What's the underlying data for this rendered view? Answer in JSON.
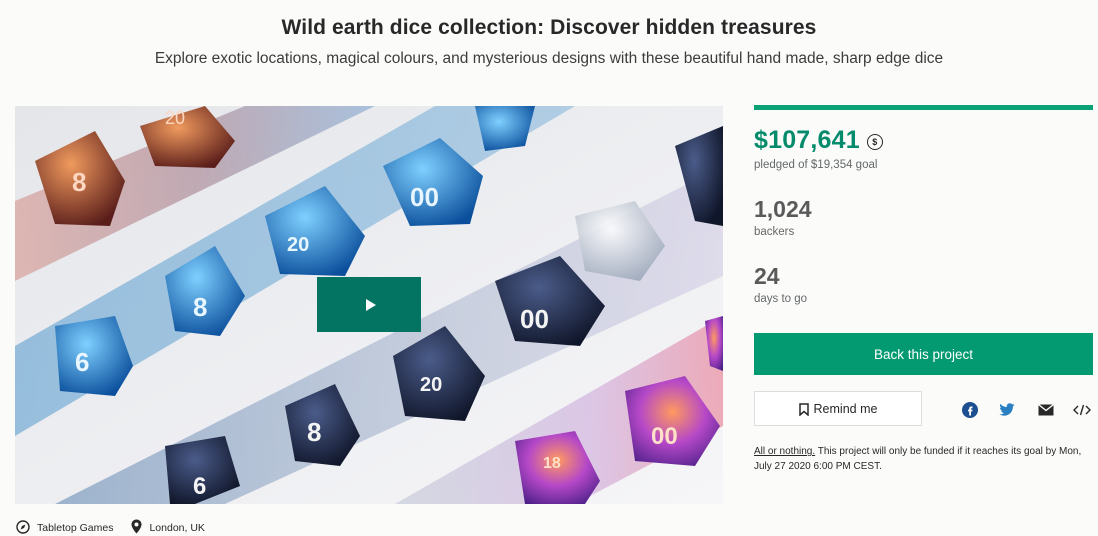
{
  "project": {
    "title": "Wild earth dice collection: Discover hidden treasures",
    "subtitle": "Explore exotic locations, magical colours, and mysterious designs with these beautiful hand made, sharp edge dice"
  },
  "media": {
    "play_icon": "play-icon"
  },
  "stats": {
    "funded_fraction": 1.0,
    "pledged_amount": "$107,641",
    "currency_icon": "currency-conversion-icon",
    "pledged_label": "pledged of $19,354 goal",
    "backers_count": "1,024",
    "backers_label": "backers",
    "days_count": "24",
    "days_label": "days to go"
  },
  "actions": {
    "back_label": "Back this project",
    "remind_label": "Remind me"
  },
  "share": {
    "icons": [
      "facebook-icon",
      "twitter-icon",
      "email-icon",
      "embed-icon"
    ]
  },
  "fine_print": {
    "link_text": "All or nothing.",
    "text": " This project will only be funded if it reaches its goal by Mon, July 27 2020 6:00 PM CEST."
  },
  "meta": {
    "category": "Tabletop Games",
    "location": "London, UK"
  },
  "colors": {
    "accent": "#039a71",
    "pledged": "#038b6c",
    "play_button": "#037362",
    "facebook": "#1877f2",
    "twitter": "#1da1f2"
  }
}
